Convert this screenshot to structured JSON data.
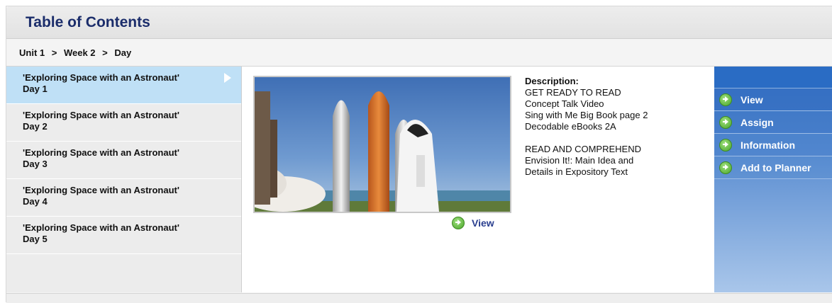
{
  "header": {
    "title": "Table of Contents"
  },
  "breadcrumb": {
    "unit": "Unit 1",
    "week": "Week 2",
    "day": "Day",
    "sep": ">"
  },
  "days": [
    {
      "line1": "'Exploring Space with an Astronaut'",
      "line2": "Day 1"
    },
    {
      "line1": "'Exploring Space with an Astronaut'",
      "line2": "Day 2"
    },
    {
      "line1": "'Exploring Space with an Astronaut'",
      "line2": "Day 3"
    },
    {
      "line1": "'Exploring Space with an Astronaut'",
      "line2": "Day 4"
    },
    {
      "line1": "'Exploring Space with an Astronaut'",
      "line2": "Day 5"
    }
  ],
  "main": {
    "view_label": "View",
    "description": {
      "heading": "Description:",
      "lines": [
        "GET READY TO READ",
        "Concept Talk Video",
        "Sing with Me Big Book page 2",
        "Decodable eBooks 2A",
        "",
        "READ AND COMPREHEND",
        "Envision It!: Main Idea and",
        "Details in Expository Text"
      ]
    }
  },
  "actions": [
    {
      "label": "View",
      "icon": "go-arrow-icon"
    },
    {
      "label": "Assign",
      "icon": "go-arrow-icon"
    },
    {
      "label": "Information",
      "icon": "go-arrow-icon"
    },
    {
      "label": "Add to Planner",
      "icon": "go-arrow-icon"
    }
  ],
  "colors": {
    "title": "#1b2d6b",
    "active_item": "#bfe0f6",
    "action_panel": "#3f78c6",
    "link": "#2a3f8f",
    "go_icon": "#4aa52a"
  }
}
